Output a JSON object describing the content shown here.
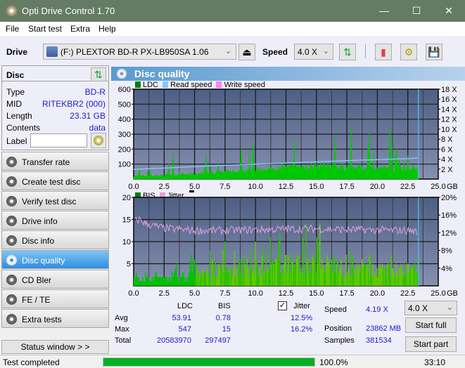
{
  "window": {
    "title": "Opti Drive Control 1.70",
    "controls": [
      "minimize",
      "maximize",
      "close"
    ]
  },
  "menu": [
    "File",
    "Start test",
    "Extra",
    "Help"
  ],
  "toolbar": {
    "drive_label": "Drive",
    "drive_value": "(F:)  PLEXTOR BD-R  PX-LB950SA 1.06",
    "speed_label": "Speed",
    "speed_value": "4.0 X"
  },
  "disc": {
    "header": "Disc",
    "rows": [
      {
        "key": "Type",
        "value": "BD-R"
      },
      {
        "key": "MID",
        "value": "RITEKBR2 (000)"
      },
      {
        "key": "Length",
        "value": "23.31 GB"
      },
      {
        "key": "Contents",
        "value": "data"
      }
    ],
    "label_key": "Label",
    "label_value": ""
  },
  "nav": [
    {
      "label": "Transfer rate",
      "active": false
    },
    {
      "label": "Create test disc",
      "active": false
    },
    {
      "label": "Verify test disc",
      "active": false
    },
    {
      "label": "Drive info",
      "active": false
    },
    {
      "label": "Disc info",
      "active": false
    },
    {
      "label": "Disc quality",
      "active": true
    },
    {
      "label": "CD Bler",
      "active": false
    },
    {
      "label": "FE / TE",
      "active": false
    },
    {
      "label": "Extra tests",
      "active": false
    }
  ],
  "status_window_label": "Status window > >",
  "panel_title": "Disc quality",
  "chart_data": [
    {
      "type": "bar",
      "title": "LDC",
      "legend": [
        "LDC",
        "Read speed",
        "Write speed"
      ],
      "colors": {
        "LDC": "#00c800",
        "Read speed": "#80c8ff",
        "Write speed": "#ff80ff"
      },
      "xlabel": "GB",
      "x_ticks": [
        "0.0",
        "2.5",
        "5.0",
        "7.5",
        "10.0",
        "12.5",
        "15.0",
        "17.5",
        "20.0",
        "22.5",
        "25.0"
      ],
      "xlim": [
        0,
        25
      ],
      "ylim": [
        0,
        600
      ],
      "y_ticks": [
        "100",
        "200",
        "300",
        "400",
        "500",
        "600"
      ],
      "y2_ticks": [
        "2 X",
        "4 X",
        "6 X",
        "8 X",
        "10 X",
        "12 X",
        "14 X",
        "16 X",
        "18 X"
      ],
      "y2lim": [
        0,
        18
      ],
      "end_gb": 23.31,
      "ldc_profile": {
        "x": [
          0,
          2.5,
          5,
          7.5,
          10,
          12.5,
          15,
          17.5,
          20,
          22.5,
          23.3
        ],
        "baseline": [
          20,
          25,
          35,
          45,
          60,
          75,
          90,
          80,
          70,
          70,
          75
        ],
        "peaks_max": 547
      },
      "read_speed": {
        "x": [
          0,
          2.5,
          5,
          7.5,
          10,
          12.5,
          15,
          17.5,
          20,
          22.5,
          23.3
        ],
        "y": [
          1.95,
          2.2,
          2.5,
          2.75,
          3.0,
          3.2,
          3.45,
          3.7,
          3.9,
          4.1,
          4.19
        ]
      }
    },
    {
      "type": "bar",
      "title": "BIS",
      "legend": [
        "BIS",
        "Jitter"
      ],
      "colors": {
        "BIS": "#00c800",
        "Jitter": "#e0a0e0"
      },
      "xlabel": "GB",
      "x_ticks": [
        "0.0",
        "2.5",
        "5.0",
        "7.5",
        "10.0",
        "12.5",
        "15.0",
        "17.5",
        "20.0",
        "22.5",
        "25.0"
      ],
      "xlim": [
        0,
        25
      ],
      "ylim": [
        0,
        20
      ],
      "y_ticks": [
        "5",
        "10",
        "15",
        "20"
      ],
      "y2_ticks": [
        "4%",
        "8%",
        "12%",
        "16%",
        "20%"
      ],
      "y2lim": [
        0,
        20
      ],
      "end_gb": 23.31,
      "bis_profile": {
        "x": [
          0,
          2.5,
          5,
          7.5,
          10,
          12.5,
          15,
          17.5,
          20,
          22.5,
          23.3
        ],
        "typical": [
          2,
          2,
          3,
          4,
          5,
          6,
          6,
          4,
          4,
          4,
          5
        ],
        "peak": [
          3,
          3,
          8,
          10,
          11,
          13,
          15,
          10,
          9,
          8,
          9
        ]
      },
      "jitter": {
        "x": [
          0,
          0.5,
          1,
          2.5,
          5,
          7.5,
          10,
          12.5,
          15,
          17.5,
          20,
          22.5,
          23.3
        ],
        "y": [
          14.5,
          15,
          14,
          13,
          12.5,
          12.5,
          12.7,
          12.8,
          12.9,
          12.7,
          12.6,
          12.5,
          12.3
        ]
      }
    }
  ],
  "stats": {
    "col_ldc": "LDC",
    "col_bis": "BIS",
    "jitter_label": "Jitter",
    "jitter_checked": true,
    "rows": [
      {
        "label": "Avg",
        "ldc": "53.91",
        "bis": "0.78",
        "jitter": "12.5%"
      },
      {
        "label": "Max",
        "ldc": "547",
        "bis": "15",
        "jitter": "16.2%"
      },
      {
        "label": "Total",
        "ldc": "20583970",
        "bis": "297497",
        "jitter": ""
      }
    ],
    "speed_label": "Speed",
    "speed_value": "4.19 X",
    "position_label": "Position",
    "position_value": "23862 MB",
    "samples_label": "Samples",
    "samples_value": "381534",
    "speed_select": "4.0 X",
    "start_full": "Start full",
    "start_part": "Start part"
  },
  "statusbar": {
    "text": "Test completed",
    "progress": 100.0,
    "progress_text": "100.0%",
    "time": "33:10"
  }
}
